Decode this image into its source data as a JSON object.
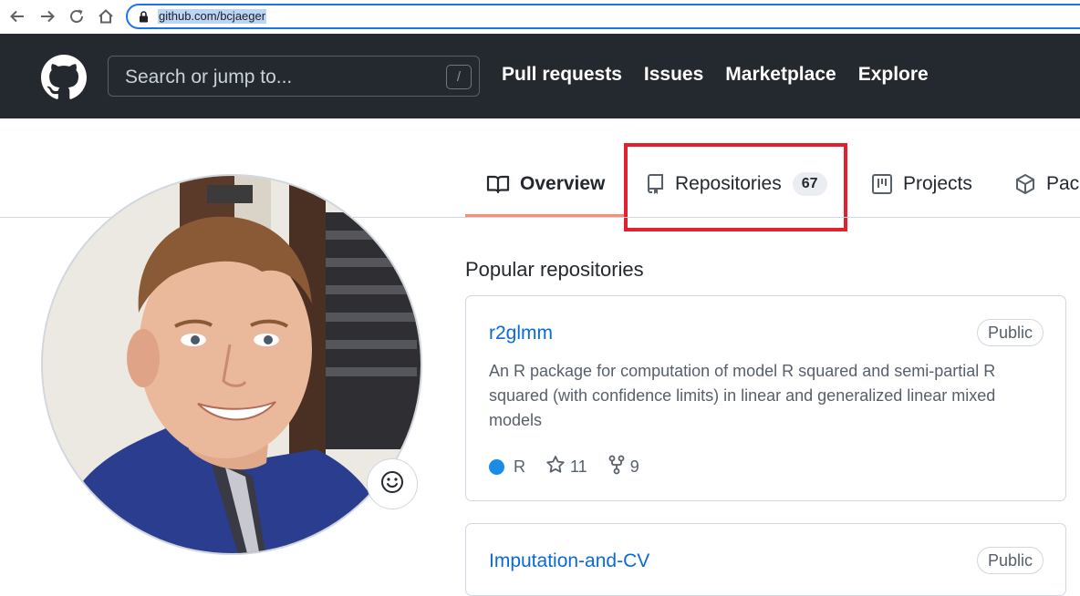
{
  "browser": {
    "url": "github.com/bcjaeger",
    "icons": [
      "back-arrow-icon",
      "forward-arrow-icon",
      "reload-icon",
      "home-icon",
      "lock-icon"
    ]
  },
  "header": {
    "search_placeholder": "Search or jump to...",
    "search_shortcut": "/",
    "nav": {
      "pull_requests": "Pull requests",
      "issues": "Issues",
      "marketplace": "Marketplace",
      "explore": "Explore"
    }
  },
  "tabs": {
    "overview": "Overview",
    "repositories": "Repositories",
    "repositories_count": "67",
    "projects": "Projects",
    "packages": "Pack"
  },
  "popular": {
    "title": "Popular repositories",
    "repos": [
      {
        "name": "r2glmm",
        "visibility": "Public",
        "description": "An R package for computation of model R squared and semi-partial R squared (with confidence limits) in linear and generalized linear mixed models",
        "language": "R",
        "stars": "11",
        "forks": "9"
      },
      {
        "name": "Imputation-and-CV",
        "visibility": "Public"
      }
    ]
  },
  "colors": {
    "header_bg": "#24292f",
    "link": "#0969da",
    "tab_underline": "#fd8c73",
    "highlight_box": "#e3202e",
    "lang_r": "#198ce7"
  }
}
